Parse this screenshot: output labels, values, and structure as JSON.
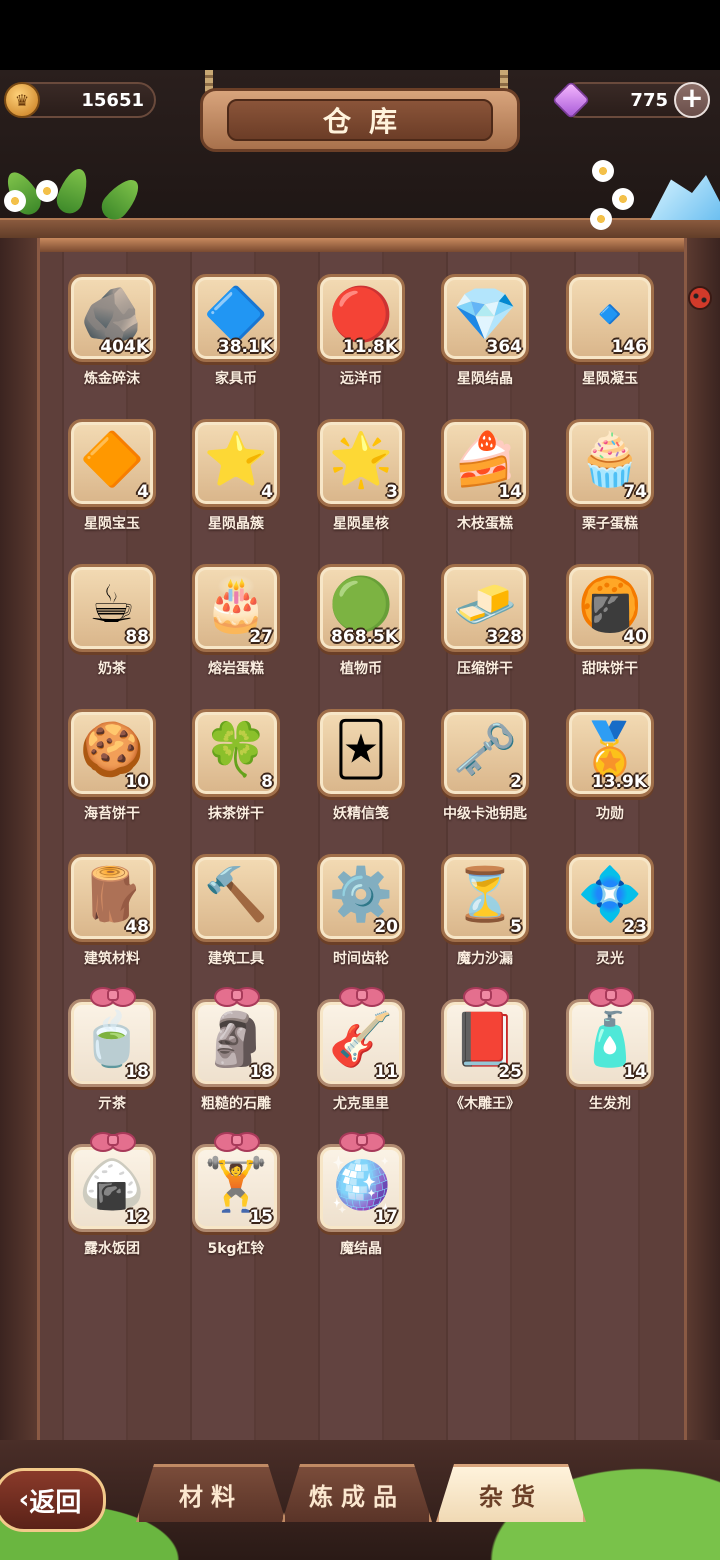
{
  "header": {
    "title": "仓库",
    "coins": "15651",
    "gems": "775"
  },
  "items": [
    {
      "label": "炼金碎沫",
      "count": "404K",
      "icon": "ore-rocks-icon",
      "glyph": "🪨",
      "special": false
    },
    {
      "label": "家具币",
      "count": "38.1K",
      "icon": "furniture-coin-icon",
      "glyph": "🔷",
      "special": false
    },
    {
      "label": "远洋币",
      "count": "11.8K",
      "icon": "ocean-coin-icon",
      "glyph": "🔴",
      "special": false
    },
    {
      "label": "星陨结晶",
      "count": "364",
      "icon": "star-crystal-icon",
      "glyph": "💎",
      "special": false
    },
    {
      "label": "星陨凝玉",
      "count": "146",
      "icon": "star-jade-icon",
      "glyph": "🔹",
      "special": false
    },
    {
      "label": "星陨宝玉",
      "count": "4",
      "icon": "yellow-gem-icon",
      "glyph": "🔶",
      "special": false
    },
    {
      "label": "星陨晶簇",
      "count": "4",
      "icon": "yellow-crystal-icon",
      "glyph": "⭐",
      "special": false
    },
    {
      "label": "星陨星核",
      "count": "3",
      "icon": "star-core-icon",
      "glyph": "🌟",
      "special": false
    },
    {
      "label": "木枝蛋糕",
      "count": "14",
      "icon": "log-cake-icon",
      "glyph": "🍰",
      "special": false
    },
    {
      "label": "栗子蛋糕",
      "count": "74",
      "icon": "chestnut-cake-icon",
      "glyph": "🧁",
      "special": false
    },
    {
      "label": "奶茶",
      "count": "88",
      "icon": "milk-tea-icon",
      "glyph": "☕",
      "special": false
    },
    {
      "label": "熔岩蛋糕",
      "count": "27",
      "icon": "lava-cake-icon",
      "glyph": "🎂",
      "special": false
    },
    {
      "label": "植物币",
      "count": "868.5K",
      "icon": "plant-coin-icon",
      "glyph": "🟢",
      "special": false
    },
    {
      "label": "压缩饼干",
      "count": "328",
      "icon": "compressed-biscuit-icon",
      "glyph": "🧈",
      "special": false
    },
    {
      "label": "甜味饼干",
      "count": "40",
      "icon": "sweet-cracker-icon",
      "glyph": "🍘",
      "special": false
    },
    {
      "label": "海苔饼干",
      "count": "10",
      "icon": "seaweed-cracker-icon",
      "glyph": "🍪",
      "special": false
    },
    {
      "label": "抹茶饼干",
      "count": "8",
      "icon": "matcha-cookie-icon",
      "glyph": "🍀",
      "special": false
    },
    {
      "label": "妖精信笺",
      "count": "",
      "icon": "fairy-letter-icon",
      "glyph": "🃏",
      "special": false
    },
    {
      "label": "中级卡池钥匙",
      "count": "2",
      "icon": "key-icon",
      "glyph": "🗝️",
      "special": false
    },
    {
      "label": "功勋",
      "count": "13.9K",
      "icon": "merit-medal-icon",
      "glyph": "🏅",
      "special": false
    },
    {
      "label": "建筑材料",
      "count": "48",
      "icon": "building-material-icon",
      "glyph": "🪵",
      "special": false
    },
    {
      "label": "建筑工具",
      "count": "",
      "icon": "hammer-tools-icon",
      "glyph": "🔨",
      "special": false
    },
    {
      "label": "时间齿轮",
      "count": "20",
      "icon": "gears-icon",
      "glyph": "⚙️",
      "special": false
    },
    {
      "label": "魔力沙漏",
      "count": "5",
      "icon": "hourglass-icon",
      "glyph": "⏳",
      "special": false
    },
    {
      "label": "灵光",
      "count": "23",
      "icon": "spirit-light-icon",
      "glyph": "💠",
      "special": false
    },
    {
      "label": "亓茶",
      "count": "18",
      "icon": "tea-bowl-icon",
      "glyph": "🍵",
      "special": true
    },
    {
      "label": "粗糙的石雕",
      "count": "18",
      "icon": "stone-statue-icon",
      "glyph": "🗿",
      "special": true
    },
    {
      "label": "尤克里里",
      "count": "11",
      "icon": "ukulele-icon",
      "glyph": "🎸",
      "special": true
    },
    {
      "label": "《木雕王》",
      "count": "25",
      "icon": "book-icon",
      "glyph": "📕",
      "special": true
    },
    {
      "label": "生发剂",
      "count": "14",
      "icon": "tonic-bottle-icon",
      "glyph": "🧴",
      "special": true
    },
    {
      "label": "露水饭团",
      "count": "12",
      "icon": "rice-ball-icon",
      "glyph": "🍙",
      "special": true
    },
    {
      "label": "5kg杠铃",
      "count": "15",
      "icon": "dumbbell-icon",
      "glyph": "🏋️",
      "special": true
    },
    {
      "label": "魔结晶",
      "count": "17",
      "icon": "magic-crystal-icon",
      "glyph": "🪩",
      "special": true
    }
  ],
  "tabs": [
    {
      "label": "材料",
      "active": false
    },
    {
      "label": "炼成品",
      "active": false
    },
    {
      "label": "杂货",
      "active": true
    }
  ],
  "back_label": "返回"
}
